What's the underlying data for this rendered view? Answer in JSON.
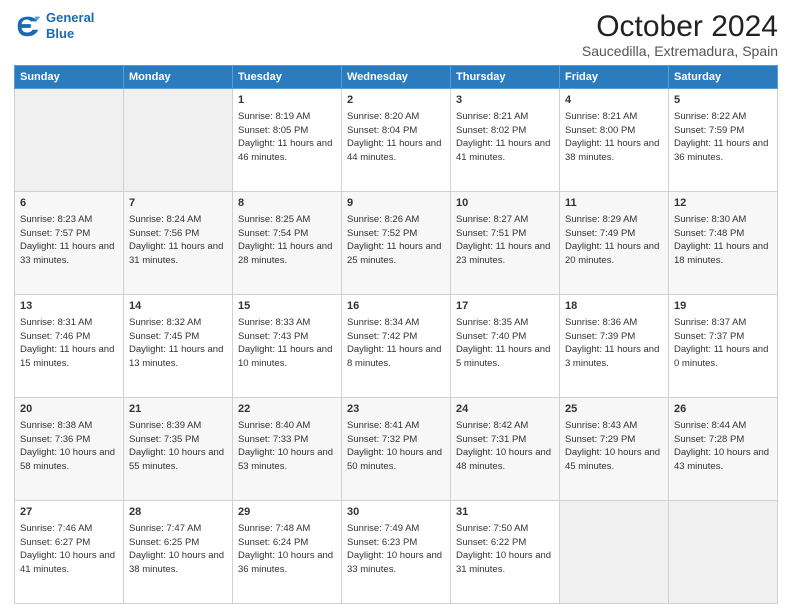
{
  "header": {
    "logo_line1": "General",
    "logo_line2": "Blue",
    "main_title": "October 2024",
    "sub_title": "Saucedilla, Extremadura, Spain"
  },
  "days_of_week": [
    "Sunday",
    "Monday",
    "Tuesday",
    "Wednesday",
    "Thursday",
    "Friday",
    "Saturday"
  ],
  "weeks": [
    [
      {
        "day": "",
        "sunrise": "",
        "sunset": "",
        "daylight": "",
        "empty": true
      },
      {
        "day": "",
        "sunrise": "",
        "sunset": "",
        "daylight": "",
        "empty": true
      },
      {
        "day": "1",
        "sunrise": "Sunrise: 8:19 AM",
        "sunset": "Sunset: 8:05 PM",
        "daylight": "Daylight: 11 hours and 46 minutes.",
        "empty": false
      },
      {
        "day": "2",
        "sunrise": "Sunrise: 8:20 AM",
        "sunset": "Sunset: 8:04 PM",
        "daylight": "Daylight: 11 hours and 44 minutes.",
        "empty": false
      },
      {
        "day": "3",
        "sunrise": "Sunrise: 8:21 AM",
        "sunset": "Sunset: 8:02 PM",
        "daylight": "Daylight: 11 hours and 41 minutes.",
        "empty": false
      },
      {
        "day": "4",
        "sunrise": "Sunrise: 8:21 AM",
        "sunset": "Sunset: 8:00 PM",
        "daylight": "Daylight: 11 hours and 38 minutes.",
        "empty": false
      },
      {
        "day": "5",
        "sunrise": "Sunrise: 8:22 AM",
        "sunset": "Sunset: 7:59 PM",
        "daylight": "Daylight: 11 hours and 36 minutes.",
        "empty": false
      }
    ],
    [
      {
        "day": "6",
        "sunrise": "Sunrise: 8:23 AM",
        "sunset": "Sunset: 7:57 PM",
        "daylight": "Daylight: 11 hours and 33 minutes.",
        "empty": false
      },
      {
        "day": "7",
        "sunrise": "Sunrise: 8:24 AM",
        "sunset": "Sunset: 7:56 PM",
        "daylight": "Daylight: 11 hours and 31 minutes.",
        "empty": false
      },
      {
        "day": "8",
        "sunrise": "Sunrise: 8:25 AM",
        "sunset": "Sunset: 7:54 PM",
        "daylight": "Daylight: 11 hours and 28 minutes.",
        "empty": false
      },
      {
        "day": "9",
        "sunrise": "Sunrise: 8:26 AM",
        "sunset": "Sunset: 7:52 PM",
        "daylight": "Daylight: 11 hours and 25 minutes.",
        "empty": false
      },
      {
        "day": "10",
        "sunrise": "Sunrise: 8:27 AM",
        "sunset": "Sunset: 7:51 PM",
        "daylight": "Daylight: 11 hours and 23 minutes.",
        "empty": false
      },
      {
        "day": "11",
        "sunrise": "Sunrise: 8:29 AM",
        "sunset": "Sunset: 7:49 PM",
        "daylight": "Daylight: 11 hours and 20 minutes.",
        "empty": false
      },
      {
        "day": "12",
        "sunrise": "Sunrise: 8:30 AM",
        "sunset": "Sunset: 7:48 PM",
        "daylight": "Daylight: 11 hours and 18 minutes.",
        "empty": false
      }
    ],
    [
      {
        "day": "13",
        "sunrise": "Sunrise: 8:31 AM",
        "sunset": "Sunset: 7:46 PM",
        "daylight": "Daylight: 11 hours and 15 minutes.",
        "empty": false
      },
      {
        "day": "14",
        "sunrise": "Sunrise: 8:32 AM",
        "sunset": "Sunset: 7:45 PM",
        "daylight": "Daylight: 11 hours and 13 minutes.",
        "empty": false
      },
      {
        "day": "15",
        "sunrise": "Sunrise: 8:33 AM",
        "sunset": "Sunset: 7:43 PM",
        "daylight": "Daylight: 11 hours and 10 minutes.",
        "empty": false
      },
      {
        "day": "16",
        "sunrise": "Sunrise: 8:34 AM",
        "sunset": "Sunset: 7:42 PM",
        "daylight": "Daylight: 11 hours and 8 minutes.",
        "empty": false
      },
      {
        "day": "17",
        "sunrise": "Sunrise: 8:35 AM",
        "sunset": "Sunset: 7:40 PM",
        "daylight": "Daylight: 11 hours and 5 minutes.",
        "empty": false
      },
      {
        "day": "18",
        "sunrise": "Sunrise: 8:36 AM",
        "sunset": "Sunset: 7:39 PM",
        "daylight": "Daylight: 11 hours and 3 minutes.",
        "empty": false
      },
      {
        "day": "19",
        "sunrise": "Sunrise: 8:37 AM",
        "sunset": "Sunset: 7:37 PM",
        "daylight": "Daylight: 11 hours and 0 minutes.",
        "empty": false
      }
    ],
    [
      {
        "day": "20",
        "sunrise": "Sunrise: 8:38 AM",
        "sunset": "Sunset: 7:36 PM",
        "daylight": "Daylight: 10 hours and 58 minutes.",
        "empty": false
      },
      {
        "day": "21",
        "sunrise": "Sunrise: 8:39 AM",
        "sunset": "Sunset: 7:35 PM",
        "daylight": "Daylight: 10 hours and 55 minutes.",
        "empty": false
      },
      {
        "day": "22",
        "sunrise": "Sunrise: 8:40 AM",
        "sunset": "Sunset: 7:33 PM",
        "daylight": "Daylight: 10 hours and 53 minutes.",
        "empty": false
      },
      {
        "day": "23",
        "sunrise": "Sunrise: 8:41 AM",
        "sunset": "Sunset: 7:32 PM",
        "daylight": "Daylight: 10 hours and 50 minutes.",
        "empty": false
      },
      {
        "day": "24",
        "sunrise": "Sunrise: 8:42 AM",
        "sunset": "Sunset: 7:31 PM",
        "daylight": "Daylight: 10 hours and 48 minutes.",
        "empty": false
      },
      {
        "day": "25",
        "sunrise": "Sunrise: 8:43 AM",
        "sunset": "Sunset: 7:29 PM",
        "daylight": "Daylight: 10 hours and 45 minutes.",
        "empty": false
      },
      {
        "day": "26",
        "sunrise": "Sunrise: 8:44 AM",
        "sunset": "Sunset: 7:28 PM",
        "daylight": "Daylight: 10 hours and 43 minutes.",
        "empty": false
      }
    ],
    [
      {
        "day": "27",
        "sunrise": "Sunrise: 7:46 AM",
        "sunset": "Sunset: 6:27 PM",
        "daylight": "Daylight: 10 hours and 41 minutes.",
        "empty": false
      },
      {
        "day": "28",
        "sunrise": "Sunrise: 7:47 AM",
        "sunset": "Sunset: 6:25 PM",
        "daylight": "Daylight: 10 hours and 38 minutes.",
        "empty": false
      },
      {
        "day": "29",
        "sunrise": "Sunrise: 7:48 AM",
        "sunset": "Sunset: 6:24 PM",
        "daylight": "Daylight: 10 hours and 36 minutes.",
        "empty": false
      },
      {
        "day": "30",
        "sunrise": "Sunrise: 7:49 AM",
        "sunset": "Sunset: 6:23 PM",
        "daylight": "Daylight: 10 hours and 33 minutes.",
        "empty": false
      },
      {
        "day": "31",
        "sunrise": "Sunrise: 7:50 AM",
        "sunset": "Sunset: 6:22 PM",
        "daylight": "Daylight: 10 hours and 31 minutes.",
        "empty": false
      },
      {
        "day": "",
        "sunrise": "",
        "sunset": "",
        "daylight": "",
        "empty": true
      },
      {
        "day": "",
        "sunrise": "",
        "sunset": "",
        "daylight": "",
        "empty": true
      }
    ]
  ]
}
